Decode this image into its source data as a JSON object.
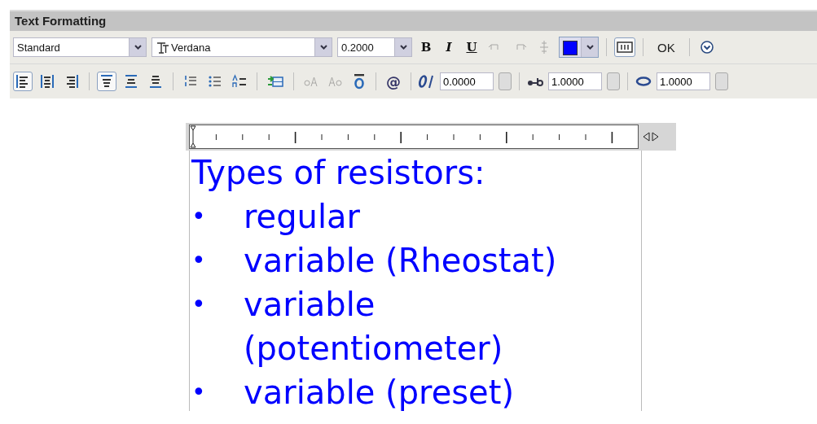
{
  "window": {
    "title": "Text Formatting"
  },
  "toolbar": {
    "style": {
      "value": "Standard"
    },
    "font": {
      "value": "Verdana"
    },
    "height": {
      "value": "0.2000"
    },
    "format_buttons": [
      {
        "label": "B",
        "kind": "bold",
        "selected": false
      },
      {
        "label": "I",
        "kind": "italic",
        "selected": false
      },
      {
        "label": "U",
        "kind": "underline",
        "selected": false
      }
    ],
    "history_buttons": [
      {
        "disabled": true
      },
      {
        "disabled": true
      },
      {
        "disabled": true
      }
    ],
    "color": "#0000ff",
    "ok_label": "OK"
  },
  "paragraph": {
    "horizontal": [
      {
        "selected": true
      },
      {
        "selected": false
      },
      {
        "selected": false
      }
    ],
    "vertical": [
      {
        "selected": true
      },
      {
        "selected": false
      },
      {
        "selected": false
      }
    ],
    "case_buttons": [
      {
        "disabled": true
      },
      {
        "disabled": true
      }
    ],
    "symbol_label": "@",
    "oblique": "0.0000",
    "tracking": "1.0000",
    "width_factor": "1.0000"
  },
  "editor": {
    "heading": "Types of resistors:",
    "items": [
      {
        "bullet": "•",
        "lines": [
          "regular"
        ]
      },
      {
        "bullet": "•",
        "lines": [
          "variable (Rheostat)"
        ]
      },
      {
        "bullet": "•",
        "lines": [
          "variable",
          "(potentiometer)"
        ]
      },
      {
        "bullet": "•",
        "lines": [
          "variable (preset)"
        ]
      }
    ]
  }
}
